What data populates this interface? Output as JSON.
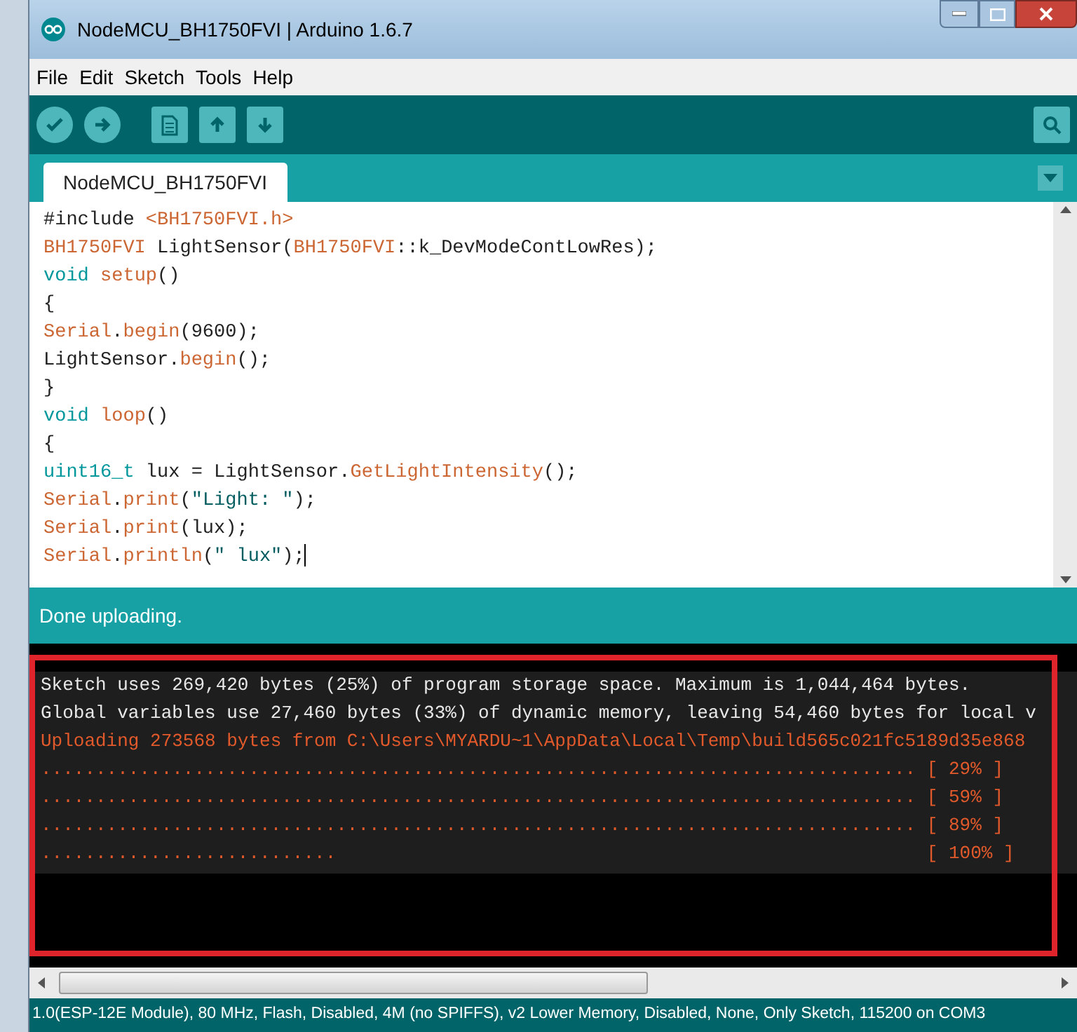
{
  "window": {
    "title": "NodeMCU_BH1750FVI | Arduino 1.6.7"
  },
  "menu": [
    {
      "label": "File"
    },
    {
      "label": "Edit"
    },
    {
      "label": "Sketch"
    },
    {
      "label": "Tools"
    },
    {
      "label": "Help"
    }
  ],
  "tabs": [
    {
      "label": "NodeMCU_BH1750FVI",
      "selected": true
    }
  ],
  "editor": {
    "lines": [
      [
        {
          "kind": "plain",
          "text": "#include "
        },
        {
          "kind": "func",
          "text": "<BH1750FVI.h>"
        }
      ],
      [
        {
          "kind": "func",
          "text": "BH1750FVI"
        },
        {
          "kind": "plain",
          "text": " LightSensor("
        },
        {
          "kind": "func",
          "text": "BH1750FVI"
        },
        {
          "kind": "plain",
          "text": "::k_DevModeContLowRes);"
        }
      ],
      [
        {
          "kind": "keyword",
          "text": "void "
        },
        {
          "kind": "func",
          "text": "setup"
        },
        {
          "kind": "plain",
          "text": "()"
        }
      ],
      [
        {
          "kind": "plain",
          "text": "{"
        }
      ],
      [
        {
          "kind": "func",
          "text": "Serial"
        },
        {
          "kind": "plain",
          "text": "."
        },
        {
          "kind": "func",
          "text": "begin"
        },
        {
          "kind": "plain",
          "text": "(9600);"
        }
      ],
      [
        {
          "kind": "plain",
          "text": "LightSensor."
        },
        {
          "kind": "func",
          "text": "begin"
        },
        {
          "kind": "plain",
          "text": "();"
        }
      ],
      [
        {
          "kind": "plain",
          "text": "}"
        }
      ],
      [
        {
          "kind": "keyword",
          "text": "void "
        },
        {
          "kind": "func",
          "text": "loop"
        },
        {
          "kind": "plain",
          "text": "()"
        }
      ],
      [
        {
          "kind": "plain",
          "text": "{"
        }
      ],
      [
        {
          "kind": "keyword",
          "text": "uint16_t"
        },
        {
          "kind": "plain",
          "text": " lux = LightSensor."
        },
        {
          "kind": "func",
          "text": "GetLightIntensity"
        },
        {
          "kind": "plain",
          "text": "();"
        }
      ],
      [
        {
          "kind": "func",
          "text": "Serial"
        },
        {
          "kind": "plain",
          "text": "."
        },
        {
          "kind": "func",
          "text": "print"
        },
        {
          "kind": "plain",
          "text": "("
        },
        {
          "kind": "string",
          "text": "\"Light: \""
        },
        {
          "kind": "plain",
          "text": ");"
        }
      ],
      [
        {
          "kind": "func",
          "text": "Serial"
        },
        {
          "kind": "plain",
          "text": "."
        },
        {
          "kind": "func",
          "text": "print"
        },
        {
          "kind": "plain",
          "text": "(lux);"
        }
      ],
      [
        {
          "kind": "func",
          "text": "Serial"
        },
        {
          "kind": "plain",
          "text": "."
        },
        {
          "kind": "func",
          "text": "println"
        },
        {
          "kind": "plain",
          "text": "("
        },
        {
          "kind": "string",
          "text": "\" lux\""
        },
        {
          "kind": "plain",
          "text": ");"
        }
      ]
    ]
  },
  "message": "Done uploading.",
  "console": [
    {
      "kind": "info",
      "text": "Sketch uses 269,420 bytes (25%) of program storage space. Maximum is 1,044,464 bytes."
    },
    {
      "kind": "info",
      "text": "Global variables use 27,460 bytes (33%) of dynamic memory, leaving 54,460 bytes for local v"
    },
    {
      "kind": "upload",
      "text": "Uploading 273568 bytes from C:\\Users\\MYARDU~1\\AppData\\Local\\Temp\\build565c021fc5189d35e868"
    },
    {
      "kind": "upload",
      "text": "................................................................................ [ 29% ]"
    },
    {
      "kind": "upload",
      "text": "................................................................................ [ 59% ]"
    },
    {
      "kind": "upload",
      "text": "................................................................................ [ 89% ]"
    },
    {
      "kind": "upload",
      "text": "...........................                                                      [ 100% ]"
    }
  ],
  "status_bar": "1.0(ESP-12E Module), 80 MHz, Flash, Disabled, 4M (no SPIFFS), v2 Lower Memory, Disabled, None, Only Sketch, 115200 on COM3"
}
